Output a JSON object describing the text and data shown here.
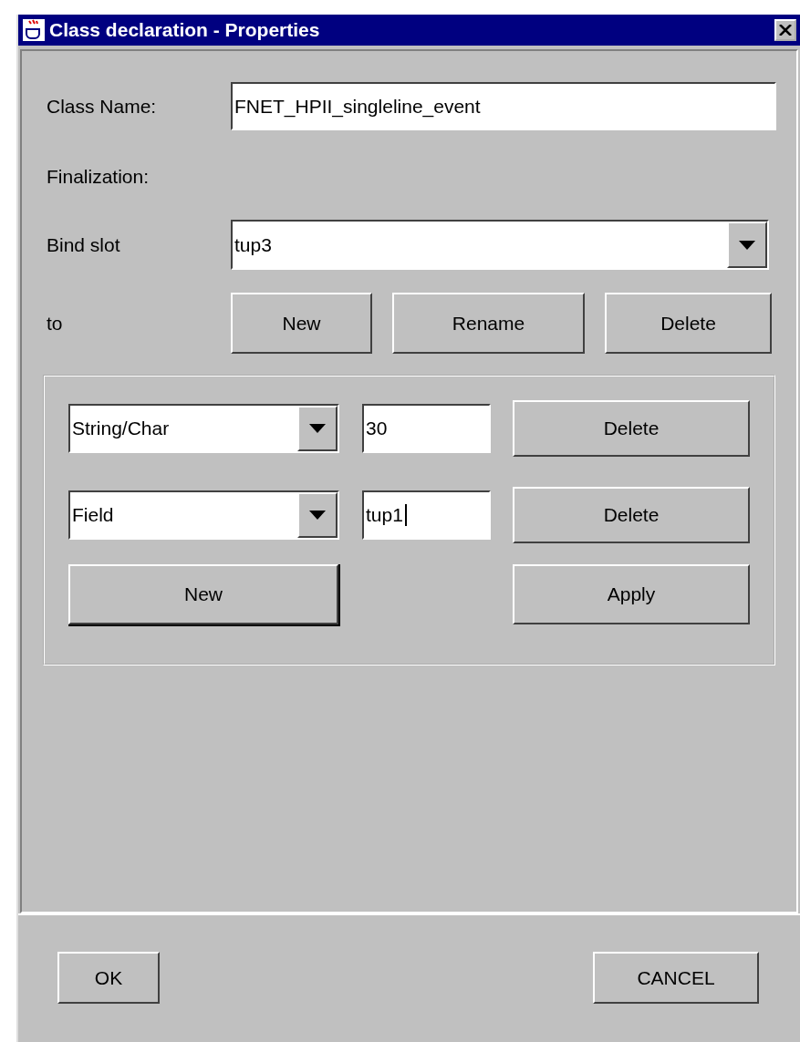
{
  "window": {
    "title": "Class declaration - Properties"
  },
  "class_name": {
    "label": "Class Name:",
    "value": "FNET_HPII_singleline_event"
  },
  "finalization": {
    "label": "Finalization:"
  },
  "bind_slot": {
    "label": "Bind slot",
    "value": "tup3"
  },
  "to_row": {
    "label": "to",
    "buttons": [
      "New",
      "Rename",
      "Delete"
    ]
  },
  "slot_rows": [
    {
      "type": "String/Char",
      "value": "30",
      "caret": false,
      "button": "Delete"
    },
    {
      "type": "Field",
      "value": "tup1",
      "caret": true,
      "button": "Delete"
    }
  ],
  "group_buttons": [
    {
      "label": "New",
      "default": true
    },
    {
      "label": "Apply",
      "default": false
    }
  ],
  "footer_buttons": [
    "OK",
    "CANCEL"
  ]
}
